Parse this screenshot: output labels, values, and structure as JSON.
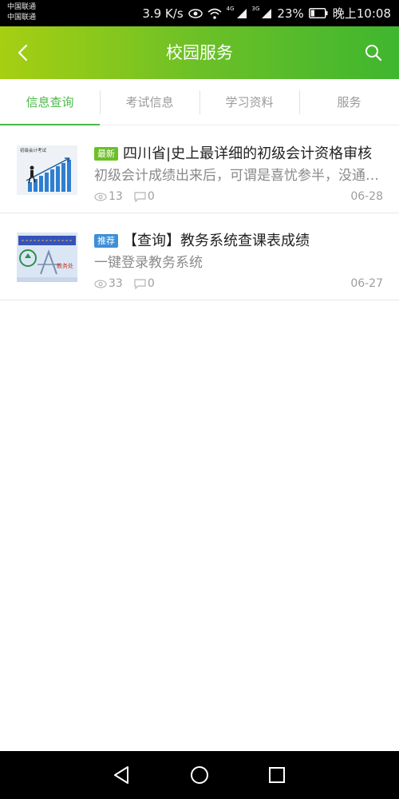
{
  "status_bar": {
    "carrier_1": "中国联通",
    "carrier_2": "中国联通",
    "speed": "3.9 K/s",
    "net_4g": "4G",
    "net_3g": "3G",
    "battery": "23%",
    "time": "晚上10:08",
    "icons": [
      "eye-icon",
      "wifi-icon",
      "signal-icon",
      "battery-icon"
    ]
  },
  "header": {
    "title": "校园服务",
    "back_icon": "chevron-left-icon",
    "search_icon": "search-icon",
    "gradient": [
      "#a6cf12",
      "#3fb62f"
    ]
  },
  "tabs": [
    {
      "label": "信息查询",
      "active": true
    },
    {
      "label": "考试信息",
      "active": false
    },
    {
      "label": "学习资料",
      "active": false
    },
    {
      "label": "服务",
      "active": false
    }
  ],
  "accent_color": "#4cb848",
  "news": [
    {
      "badge": "最新",
      "badge_color": "#6cc027",
      "title": "四川省|史上最详细的初级会计资格审核",
      "summary": "初级会计成绩出来后，可谓是喜忧参半，没通过的",
      "views": "13",
      "comments": "0",
      "date": "06-28",
      "thumb_caption": "初级会计考试"
    },
    {
      "badge": "推荐",
      "badge_color": "#3d8fd8",
      "title": "【查询】教务系统查课表成绩",
      "summary": "一键登录教务系统",
      "views": "33",
      "comments": "0",
      "date": "06-27",
      "thumb_caption": "教务处"
    }
  ],
  "nav_bar": {
    "icons": [
      "back-triangle-icon",
      "home-circle-icon",
      "recents-square-icon"
    ]
  }
}
